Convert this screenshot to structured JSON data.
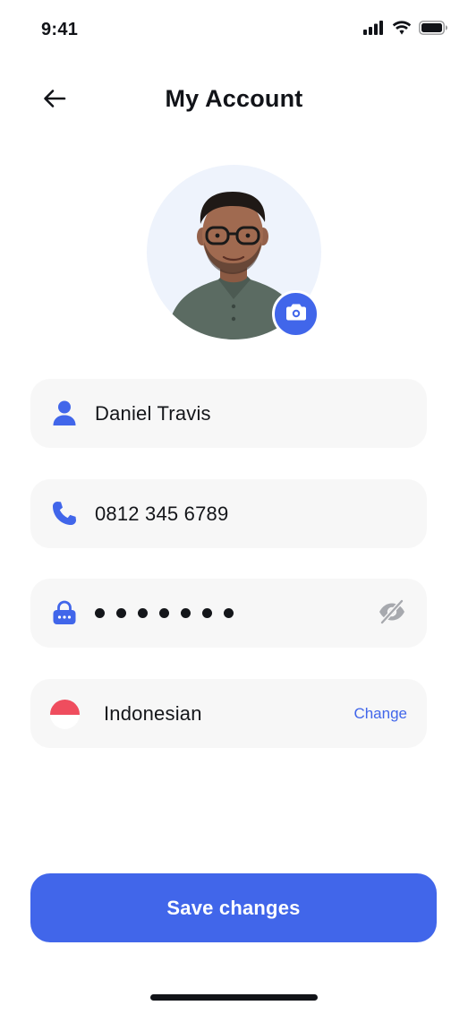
{
  "status_bar": {
    "time": "9:41",
    "icons": [
      "signal-icon",
      "wifi-icon",
      "battery-icon"
    ]
  },
  "header": {
    "title": "My Account",
    "back_icon": "arrow-left-icon"
  },
  "profile": {
    "avatar": "profile-photo",
    "edit_icon": "camera-icon"
  },
  "fields": {
    "name": {
      "icon": "user-icon",
      "value": "Daniel Travis"
    },
    "phone": {
      "icon": "phone-icon",
      "value": "0812 345 6789"
    },
    "password": {
      "icon": "lock-icon",
      "masked_length": 7,
      "toggle_icon": "eye-off-icon"
    },
    "language": {
      "flag": "indonesia-flag",
      "value": "Indonesian",
      "change_label": "Change"
    }
  },
  "actions": {
    "save_label": "Save changes"
  },
  "colors": {
    "accent": "#4166EA",
    "field_background": "#F7F7F7",
    "avatar_background": "#EEF3FC",
    "text": "#14161A",
    "muted_icon": "#A7A9AE"
  }
}
